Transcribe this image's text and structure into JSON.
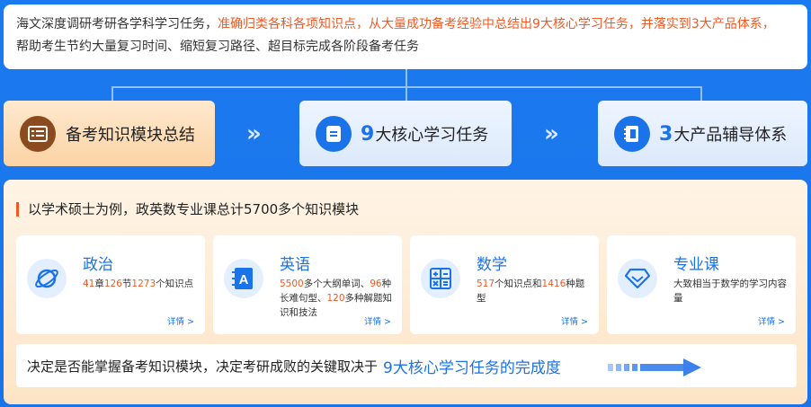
{
  "intro": {
    "line1_a": "海文深度调研考研各学科学习任务，",
    "line1_b": "准确归类各科各项知识点，从大量成功备考经验中总结出9大核心学习任务，并落实到3大产品体系，",
    "line2": "帮助考生节约大量复习时间、缩短复习路径、超目标完成各阶段备考任务"
  },
  "steps": [
    {
      "pre": "",
      "label": "备考知识模块总结"
    },
    {
      "pre": "9",
      "label": "大核心学习任务"
    },
    {
      "pre": "3",
      "label": "大产品辅导体系"
    }
  ],
  "chevron": "»",
  "panel": {
    "title": "以学术硕士为例，政英数专业课总计5700多个知识模块"
  },
  "cards": [
    {
      "title": "政治",
      "d": [
        "41",
        "章",
        "126",
        "节",
        "1273",
        "个知识点"
      ],
      "more": "详情 >"
    },
    {
      "title": "英语",
      "d": [
        "5500",
        "多个大纲单词、",
        "96",
        "种长难句型、",
        "120",
        "多种解题知识和技法"
      ],
      "more": "详情 >"
    },
    {
      "title": "数学",
      "d": [
        "517",
        "个知识点和",
        "1416",
        "种题型"
      ],
      "more": "详情 >"
    },
    {
      "title": "专业课",
      "desc": "大致相当于数学的学习内容量",
      "more": "详情 >"
    }
  ],
  "bottom": {
    "text": "决定是否能掌握备考知识模块，决定考研成败的关键取决于",
    "emphasis": "9大核心学习任务的完成度"
  },
  "colors": {
    "accent": "#1a73e8",
    "highlight": "#ef5a24",
    "brown": "#8c4a1f"
  }
}
